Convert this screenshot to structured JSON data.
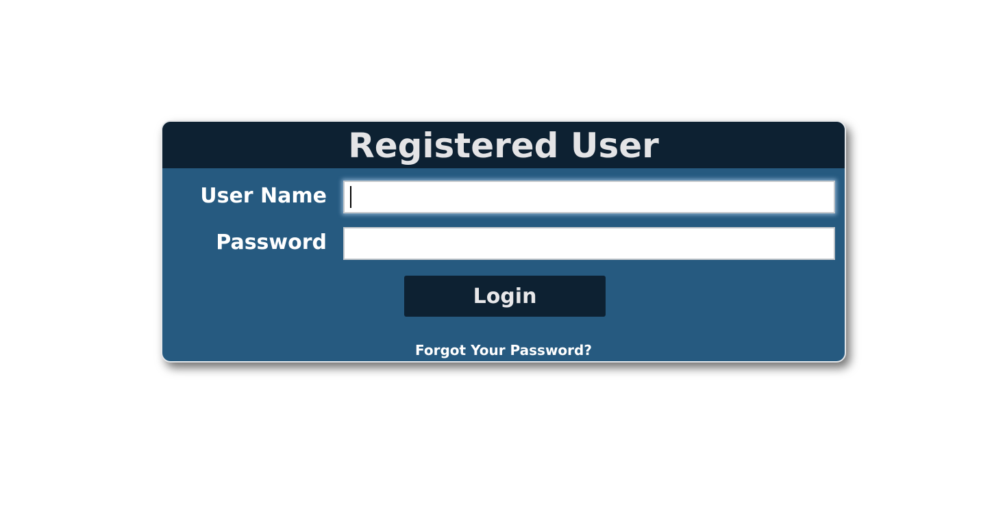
{
  "login_panel": {
    "title": "Registered User",
    "username": {
      "label": "User Name",
      "value": "",
      "focused": true
    },
    "password": {
      "label": "Password",
      "value": ""
    },
    "login_button_label": "Login",
    "forgot_password_link": "Forgot Your Password?"
  },
  "colors": {
    "panel_background": "#265a80",
    "header_background": "#0d2132",
    "button_background": "#0d2132",
    "title_text": "#e4e4e6",
    "label_text": "#ffffff",
    "page_background": "#ffffff"
  }
}
